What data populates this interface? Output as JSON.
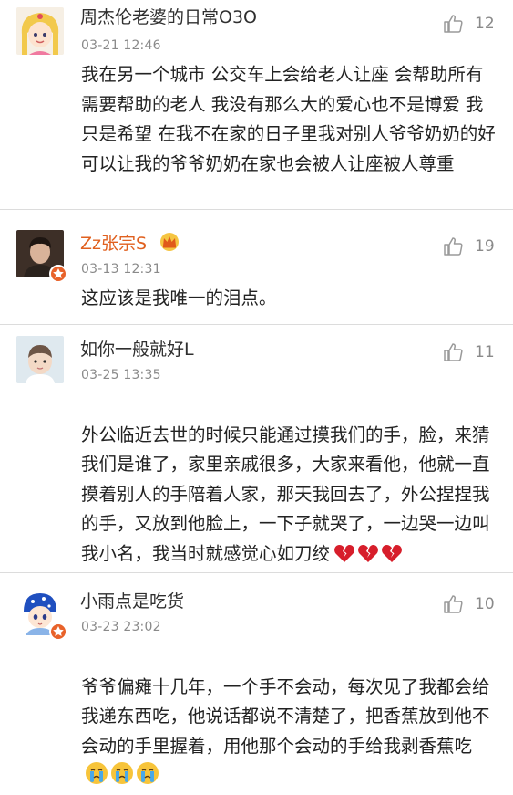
{
  "colors": {
    "divider": "#dcdcdc",
    "username": "#2f2f2f",
    "meta": "#8a8a8a",
    "body_text": "#222222",
    "verified_badge": "#e8622a",
    "heart_broken": "#d71e2b"
  },
  "comments": [
    {
      "username": "周杰伦老婆的日常O3O",
      "time": "03-21 12:46",
      "likes": "12",
      "text": "我在另一个城市 公交车上会给老人让座 会帮助所有需要帮助的老人 我没有那么大的爱心也不是博爱 我只是希望 在我不在家的日子里我对别人爷爷奶奶的好 可以让我的爷爷奶奶在家也会被人让座被人尊重",
      "avatar_icon": "cartoon-girl-avatar"
    },
    {
      "username": "Zz张宗S",
      "time": "03-13 12:31",
      "likes": "19",
      "text": "这应该是我唯一的泪点。",
      "avatar_icon": "photo-avatar",
      "badge_icon": "vip-crown-icon"
    },
    {
      "username": "如你一般就好L",
      "time": "03-25 13:35",
      "likes": "11",
      "text": "外公临近去世的时候只能通过摸我们的手，脸，来猜我们是谁了，家里亲戚很多，大家来看他，他就一直摸着别人的手陪着人家，那天我回去了，外公捏捏我的手，又放到他脸上，一下子就哭了，一边哭一边叫我小名，我当时就感觉心如刀绞",
      "avatar_icon": "child-photo-avatar",
      "emoji": [
        "broken-heart-icon",
        "broken-heart-icon",
        "broken-heart-icon"
      ]
    },
    {
      "username": "小雨点是吃货",
      "time": "03-23 23:02",
      "likes": "10",
      "text": "爷爷偏瘫十几年，一个手不会动，每次见了我都会给我递东西吃，他说话都说不清楚了，把香蕉放到他不会动的手里握着，用他那个会动的手给我剥香蕉吃",
      "avatar_icon": "blue-cap-cartoon-avatar",
      "emoji": [
        "crying-face-icon",
        "crying-face-icon",
        "crying-face-icon"
      ]
    }
  ]
}
